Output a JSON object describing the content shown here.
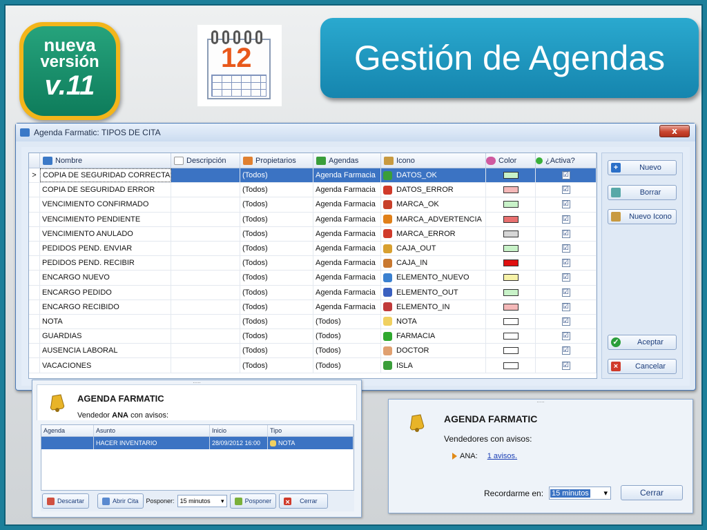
{
  "badge": {
    "line1": "nueva",
    "line2": "versión",
    "line3": "v.11"
  },
  "calendar_icon": {
    "day": "12",
    "icon": "calendar-icon"
  },
  "page_title": "Gestión de Agendas",
  "window": {
    "title": "Agenda Farmatic: TIPOS DE CITA",
    "close_label": "x",
    "columns": {
      "nombre": "Nombre",
      "descripcion": "Descripción",
      "propietarios": "Propietarios",
      "agendas": "Agendas",
      "icono": "Icono",
      "color": "Color",
      "activa": "¿Activa?"
    },
    "current_row_marker": ">",
    "rows": [
      {
        "nombre": "COPIA DE SEGURIDAD CORRECTA",
        "descripcion": "",
        "propietarios": "(Todos)",
        "agendas": "Agenda Farmacia",
        "icono": "DATOS_OK",
        "icon_color": "#3a9e3a",
        "color": "#c8f2c8",
        "activa": "☑",
        "selected": true
      },
      {
        "nombre": "COPIA DE SEGURIDAD ERROR",
        "descripcion": "",
        "propietarios": "(Todos)",
        "agendas": "Agenda Farmacia",
        "icono": "DATOS_ERROR",
        "icon_color": "#d03a2a",
        "color": "#f4b8b8",
        "activa": "☑"
      },
      {
        "nombre": "VENCIMIENTO CONFIRMADO",
        "descripcion": "",
        "propietarios": "(Todos)",
        "agendas": "Agenda Farmacia",
        "icono": "MARCA_OK",
        "icon_color": "#c8402a",
        "color": "#c8f2c8",
        "activa": "☑"
      },
      {
        "nombre": "VENCIMIENTO PENDIENTE",
        "descripcion": "",
        "propietarios": "(Todos)",
        "agendas": "Agenda Farmacia",
        "icono": "MARCA_ADVERTENCIA",
        "icon_color": "#e0801a",
        "color": "#e87070",
        "activa": "☑"
      },
      {
        "nombre": "VENCIMIENTO ANULADO",
        "descripcion": "",
        "propietarios": "(Todos)",
        "agendas": "Agenda Farmacia",
        "icono": "MARCA_ERROR",
        "icon_color": "#d03a2a",
        "color": "#d6d6d6",
        "activa": "☑"
      },
      {
        "nombre": "PEDIDOS PEND. ENVIAR",
        "descripcion": "",
        "propietarios": "(Todos)",
        "agendas": "Agenda Farmacia",
        "icono": "CAJA_OUT",
        "icon_color": "#d8a030",
        "color": "#c8f2c8",
        "activa": "☑"
      },
      {
        "nombre": "PEDIDOS PEND. RECIBIR",
        "descripcion": "",
        "propietarios": "(Todos)",
        "agendas": "Agenda Farmacia",
        "icono": "CAJA_IN",
        "icon_color": "#c87830",
        "color": "#e01010",
        "activa": "☑"
      },
      {
        "nombre": "ENCARGO NUEVO",
        "descripcion": "",
        "propietarios": "(Todos)",
        "agendas": "Agenda Farmacia",
        "icono": "ELEMENTO_NUEVO",
        "icon_color": "#3a80d0",
        "color": "#f6f2a8",
        "activa": "☑"
      },
      {
        "nombre": "ENCARGO PEDIDO",
        "descripcion": "",
        "propietarios": "(Todos)",
        "agendas": "Agenda Farmacia",
        "icono": "ELEMENTO_OUT",
        "icon_color": "#3a60c0",
        "color": "#c8f2c8",
        "activa": "☑"
      },
      {
        "nombre": "ENCARGO RECIBIDO",
        "descripcion": "",
        "propietarios": "(Todos)",
        "agendas": "Agenda Farmacia",
        "icono": "ELEMENTO_IN",
        "icon_color": "#c03a3a",
        "color": "#f4b8b8",
        "activa": "☑"
      },
      {
        "nombre": "NOTA",
        "descripcion": "",
        "propietarios": "(Todos)",
        "agendas": "(Todos)",
        "icono": "NOTA",
        "icon_color": "#f0d060",
        "color": "#ffffff",
        "activa": "☑"
      },
      {
        "nombre": "GUARDIAS",
        "descripcion": "",
        "propietarios": "(Todos)",
        "agendas": "(Todos)",
        "icono": "FARMACIA",
        "icon_color": "#2ea82e",
        "color": "#ffffff",
        "activa": "☑"
      },
      {
        "nombre": "AUSENCIA LABORAL",
        "descripcion": "",
        "propietarios": "(Todos)",
        "agendas": "(Todos)",
        "icono": "DOCTOR",
        "icon_color": "#e0a070",
        "color": "#ffffff",
        "activa": "☑"
      },
      {
        "nombre": "VACACIONES",
        "descripcion": "",
        "propietarios": "(Todos)",
        "agendas": "(Todos)",
        "icono": "ISLA",
        "icon_color": "#3a9e3a",
        "color": "#ffffff",
        "activa": "☑"
      }
    ],
    "buttons": {
      "nuevo": "Nuevo",
      "borrar": "Borrar",
      "nuevo_icono": "Nuevo Icono",
      "aceptar": "Aceptar",
      "cancelar": "Cancelar"
    }
  },
  "popup1": {
    "title": "AGENDA FARMATIC",
    "subtitle_prefix": "Vendedor",
    "subtitle_user": "ANA",
    "subtitle_suffix": "con avisos:",
    "columns": {
      "agenda": "Agenda",
      "asunto": "Asunto",
      "inicio": "Inicio",
      "tipo": "Tipo"
    },
    "row": {
      "agenda": "",
      "asunto": "HACER INVENTARIO",
      "inicio": "28/09/2012 16:00",
      "tipo": "NOTA"
    },
    "buttons": {
      "descartar": "Descartar",
      "abrir_cita": "Abrir Cita",
      "posponer": "Posponer",
      "cerrar": "Cerrar"
    },
    "posponer_label": "Posponer:",
    "posponer_value": "15 minutos",
    "grip": "....."
  },
  "popup2": {
    "title": "AGENDA FARMATIC",
    "subtitle": "Vendedores con avisos:",
    "item_user": "ANA:",
    "item_link": "1 avisos.",
    "remind_label": "Recordarme en:",
    "remind_value": "15 minutos",
    "close_label": "Cerrar",
    "grip": "....."
  },
  "colors": {
    "title_bg": "#1f97c3",
    "selection": "#3b73c3",
    "badge_ring": "#f3b51a",
    "badge_fill": "#0e7c5b"
  }
}
